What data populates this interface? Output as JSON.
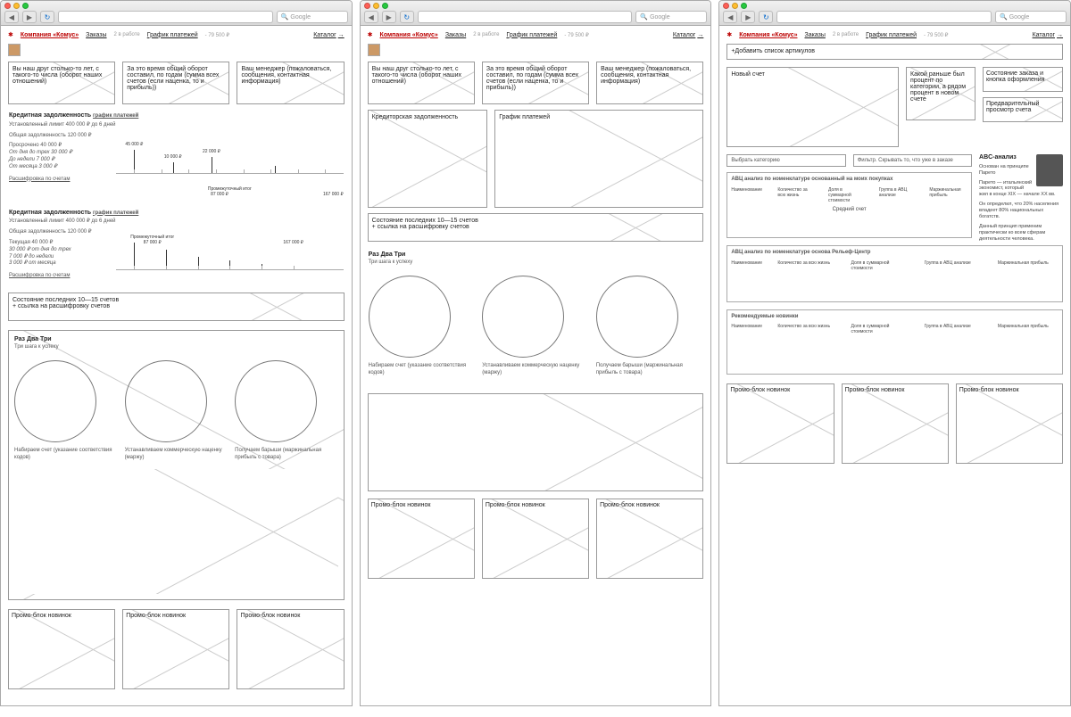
{
  "nav": {
    "brand": "Компания «Комус»",
    "orders": "Заказы",
    "orders_note": "2 в работе",
    "payments": "График платежей",
    "balance": "- 79 500 ₽",
    "catalog": "Каталог"
  },
  "search_ph": "Google",
  "cards": {
    "friend": "Вы наш друг столько-то лет, с такого-то числа (оборот наших отношений)",
    "turnover": "За это время общий оборот составил, по годам (сумма всех счетов (если наценка, то и прибыль))",
    "manager": "Ваш менеджер (пожаловаться, сообщения, контактная информация)"
  },
  "debt": {
    "title": "Кредитная задолженность",
    "schedule_link": "график платежей",
    "limit": "Установленный лимит 400 000 ₽ до 6 дней",
    "total": "Общая задолженность 120 000 ₽",
    "overdue": "Просрочено 40 000 ₽",
    "current": "Текущая 40 000 ₽",
    "line1": "От дня до трех 30 000 ₽",
    "line2": "До недели 7 000 ₽",
    "line3": "От месяца 3 000 ₽",
    "line2a": "30 000 ₽ от дня до трех",
    "line2b": "7 000 ₽ до недели",
    "line2c": "3 000 ₽ от месяца",
    "decode": "Расшифровка по счетам",
    "interm": "Промежуточный итог",
    "sum1": "87 000 ₽",
    "sum2": "167 000 ₽"
  },
  "timeline_vals": [
    "45 000 ₽",
    "10 000 ₽",
    "22 000 ₽"
  ],
  "debt2_title": "Кредиторская задолженность",
  "schedule_title": "График платежей",
  "last_invoices": "Состояние последних 10—15 счетов\n+ ссылка на расшифровку счетов",
  "steps": {
    "title": "Раз Два Три",
    "subtitle": "Три шага к успеху",
    "s1": "Набираем счет (указание соответствия кодов)",
    "s2": "Устанавливаем коммерческую наценку (маржу)",
    "s3": "Получаем барыши (маржинальная прибыль с товара)"
  },
  "promo": "Промо-блок новинок",
  "p3": {
    "add_articles": "+Добавить список артикулов",
    "new_invoice": "Новый счет",
    "percent_note": "Какой раньше был процент по категории, а рядом процент в новом счете",
    "order_state": "Состояние заказа и кнопка оформления",
    "preview": "Предварительный просмотр счета",
    "choose_cat": "Выбрать категорию",
    "filter": "Фильтр. Скрывать то, что уже в заказе",
    "abc1": "АВЦ анализ по номенклатуре основанный на моих покупках",
    "abc2": "АВЦ анализ по номенклатуре основа Рельеф-Центр",
    "recs": "Рекомендуемые новинки",
    "avg": "Средний счет",
    "nomen": "Наименование",
    "cols": [
      "Количество за всю жизнь",
      "Доля в суммарной стоимости",
      "Группа в АВЦ анализе",
      "Маржинальная прибыль"
    ],
    "abc_title": "ABC-анализ",
    "abc_sub": "Основан на принципе Парето",
    "pareto1": "Парето — итальянский экономист, который жил в конце XIX — начале XX вв.",
    "pareto2": "Он определил, что 20% населения владеет 80% национальных богатств.",
    "pareto3": "Данный принцип применим практически ко всем сферам деятельности человека."
  }
}
